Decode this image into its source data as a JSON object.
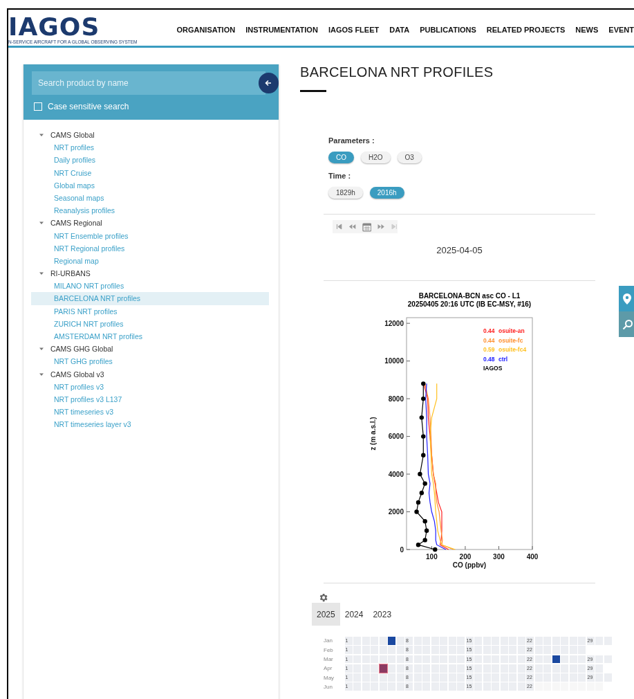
{
  "header": {
    "logo": "IAGOS",
    "tagline": "N-SERVICE AIRCRAFT FOR A GLOBAL OBSERVING SYSTEM",
    "nav": [
      "ORGANISATION",
      "INSTRUMENTATION",
      "IAGOS FLEET",
      "DATA",
      "PUBLICATIONS",
      "RELATED PROJECTS",
      "NEWS",
      "EVENT"
    ]
  },
  "sidebar": {
    "search": {
      "placeholder": "Search product by name"
    },
    "case_sensitive": {
      "label": "Case sensitive search",
      "checked": false
    },
    "tree": [
      {
        "label": "CAMS Global",
        "expanded": true,
        "children": [
          {
            "label": "NRT profiles",
            "selected": false
          },
          {
            "label": "Daily profiles",
            "selected": false
          },
          {
            "label": "NRT Cruise",
            "selected": false
          },
          {
            "label": "Global maps",
            "selected": false
          },
          {
            "label": "Seasonal maps",
            "selected": false
          },
          {
            "label": "Reanalysis profiles",
            "selected": false
          }
        ]
      },
      {
        "label": "CAMS Regional",
        "expanded": true,
        "children": [
          {
            "label": "NRT Ensemble profiles",
            "selected": false
          },
          {
            "label": "NRT Regional profiles",
            "selected": false
          },
          {
            "label": "Regional map",
            "selected": false
          }
        ]
      },
      {
        "label": "RI-URBANS",
        "expanded": true,
        "children": [
          {
            "label": "MILANO NRT profiles",
            "selected": false
          },
          {
            "label": "BARCELONA NRT profiles",
            "selected": true
          },
          {
            "label": "PARIS NRT profiles",
            "selected": false
          },
          {
            "label": "ZURICH NRT profiles",
            "selected": false
          },
          {
            "label": "AMSTERDAM NRT profiles",
            "selected": false
          }
        ]
      },
      {
        "label": "CAMS GHG Global",
        "expanded": true,
        "children": [
          {
            "label": "NRT GHG profiles",
            "selected": false
          }
        ]
      },
      {
        "label": "CAMS Global v3",
        "expanded": true,
        "children": [
          {
            "label": "NRT profiles v3",
            "selected": false
          },
          {
            "label": "NRT profiles v3 L137",
            "selected": false
          },
          {
            "label": "NRT timeseries v3",
            "selected": false
          },
          {
            "label": "NRT timeseries layer v3",
            "selected": false
          }
        ]
      }
    ]
  },
  "page_title": "BARCELONA NRT PROFILES",
  "parameters": {
    "label": "Parameters :",
    "options": [
      {
        "label": "CO",
        "selected": true
      },
      {
        "label": "H2O",
        "selected": false
      },
      {
        "label": "O3",
        "selected": false
      }
    ]
  },
  "time": {
    "label": "Time :",
    "options": [
      {
        "label": "1829h",
        "selected": false
      },
      {
        "label": "2016h",
        "selected": true
      }
    ]
  },
  "date": "2025-04-05",
  "profile": {
    "chart_data": {
      "type": "line",
      "orientation": "horizontal",
      "title": "BARCELONA-BCN asc CO - L1\n20250405 20:16 UTC (IB EC-MSY, #16)",
      "xlabel": "CO (ppbv)",
      "ylabel": "z (m a.s.l.)",
      "x": [
        0,
        250,
        500,
        1000,
        1500,
        2000,
        2500,
        3000,
        3500,
        4000,
        5000,
        6000,
        7000,
        8000,
        8800
      ],
      "xlim": [
        25,
        400
      ],
      "ylim": [
        0,
        12300
      ],
      "xticks": [
        100,
        200,
        300,
        400
      ],
      "yticks": [
        0,
        2000,
        4000,
        6000,
        8000,
        10000,
        12000
      ],
      "series": [
        {
          "name": "osuite-an",
          "color": "#ff2020",
          "values": [
            150,
            125,
            128,
            130,
            130,
            130,
            120,
            115,
            110,
            105,
            100,
            95,
            90,
            88,
            76
          ]
        },
        {
          "name": "osuite-fc",
          "color": "#ff9030",
          "values": [
            165,
            130,
            132,
            128,
            125,
            122,
            115,
            112,
            112,
            105,
            100,
            98,
            95,
            90,
            80
          ]
        },
        {
          "name": "osuite-fc4",
          "color": "#ffc020",
          "values": [
            170,
            130,
            125,
            118,
            115,
            112,
            110,
            108,
            105,
            100,
            98,
            95,
            100,
            115,
            115
          ]
        },
        {
          "name": "ctrl",
          "color": "#2020ff",
          "values": [
            142,
            115,
            112,
            112,
            108,
            100,
            95,
            92,
            95,
            90,
            88,
            85,
            85,
            82,
            85
          ]
        },
        {
          "name": "IAGOS",
          "color": "#000000",
          "marker": "circle",
          "values": [
            110,
            60,
            80,
            85,
            80,
            55,
            60,
            70,
            80,
            65,
            75,
            75,
            70,
            75,
            75
          ]
        }
      ],
      "annotations": [
        "0.44",
        "0.44",
        "0.59",
        "0.48"
      ]
    }
  },
  "years": [
    {
      "label": "2025",
      "selected": true
    },
    {
      "label": "2024",
      "selected": false
    },
    {
      "label": "2023",
      "selected": false
    }
  ],
  "calendar": [
    {
      "month": "Jan",
      "cells": [
        {
          "kind": "empty",
          "label": "1"
        },
        {
          "kind": "empty"
        },
        {
          "kind": "empty"
        },
        {
          "kind": "empty"
        },
        {
          "kind": "empty"
        },
        {
          "kind": "data"
        },
        {
          "kind": "empty"
        },
        {
          "kind": "empty",
          "label": "8"
        },
        {
          "kind": "empty"
        },
        {
          "kind": "empty"
        },
        {
          "kind": "empty"
        },
        {
          "kind": "empty"
        },
        {
          "kind": "empty"
        },
        {
          "kind": "empty"
        },
        {
          "kind": "empty",
          "label": "15"
        },
        {
          "kind": "empty"
        },
        {
          "kind": "empty"
        },
        {
          "kind": "empty"
        },
        {
          "kind": "empty"
        },
        {
          "kind": "empty"
        },
        {
          "kind": "empty"
        },
        {
          "kind": "empty",
          "label": "22"
        },
        {
          "kind": "empty"
        },
        {
          "kind": "empty"
        },
        {
          "kind": "empty"
        },
        {
          "kind": "empty"
        },
        {
          "kind": "empty"
        },
        {
          "kind": "empty"
        },
        {
          "kind": "empty",
          "label": "29"
        },
        {
          "kind": "empty"
        },
        {
          "kind": "empty"
        }
      ]
    },
    {
      "month": "Feb",
      "cells": [
        {
          "kind": "empty",
          "label": "1"
        },
        {
          "kind": "empty"
        },
        {
          "kind": "empty"
        },
        {
          "kind": "empty"
        },
        {
          "kind": "empty"
        },
        {
          "kind": "empty"
        },
        {
          "kind": "empty"
        },
        {
          "kind": "empty",
          "label": "8"
        },
        {
          "kind": "empty"
        },
        {
          "kind": "empty"
        },
        {
          "kind": "empty"
        },
        {
          "kind": "empty"
        },
        {
          "kind": "empty"
        },
        {
          "kind": "empty"
        },
        {
          "kind": "empty",
          "label": "15"
        },
        {
          "kind": "empty"
        },
        {
          "kind": "empty"
        },
        {
          "kind": "empty"
        },
        {
          "kind": "empty"
        },
        {
          "kind": "empty"
        },
        {
          "kind": "empty"
        },
        {
          "kind": "empty",
          "label": "22"
        },
        {
          "kind": "empty"
        },
        {
          "kind": "empty"
        },
        {
          "kind": "empty"
        },
        {
          "kind": "empty"
        },
        {
          "kind": "empty"
        },
        {
          "kind": "empty"
        }
      ]
    },
    {
      "month": "Mar",
      "cells": [
        {
          "kind": "empty",
          "label": "1"
        },
        {
          "kind": "empty"
        },
        {
          "kind": "empty"
        },
        {
          "kind": "empty"
        },
        {
          "kind": "empty"
        },
        {
          "kind": "empty"
        },
        {
          "kind": "empty"
        },
        {
          "kind": "empty",
          "label": "8"
        },
        {
          "kind": "empty"
        },
        {
          "kind": "empty"
        },
        {
          "kind": "empty"
        },
        {
          "kind": "empty"
        },
        {
          "kind": "empty"
        },
        {
          "kind": "empty"
        },
        {
          "kind": "empty",
          "label": "15"
        },
        {
          "kind": "empty"
        },
        {
          "kind": "empty"
        },
        {
          "kind": "empty"
        },
        {
          "kind": "empty"
        },
        {
          "kind": "empty"
        },
        {
          "kind": "empty"
        },
        {
          "kind": "empty",
          "label": "22"
        },
        {
          "kind": "empty"
        },
        {
          "kind": "empty"
        },
        {
          "kind": "data"
        },
        {
          "kind": "empty"
        },
        {
          "kind": "empty"
        },
        {
          "kind": "empty"
        },
        {
          "kind": "empty",
          "label": "29"
        },
        {
          "kind": "empty"
        },
        {
          "kind": "empty"
        }
      ]
    },
    {
      "month": "Apr",
      "cells": [
        {
          "kind": "empty",
          "label": "1"
        },
        {
          "kind": "empty"
        },
        {
          "kind": "empty"
        },
        {
          "kind": "empty"
        },
        {
          "kind": "selected"
        },
        {
          "kind": "empty"
        },
        {
          "kind": "empty"
        },
        {
          "kind": "empty",
          "label": "8"
        },
        {
          "kind": "empty"
        },
        {
          "kind": "empty"
        },
        {
          "kind": "empty"
        },
        {
          "kind": "empty"
        },
        {
          "kind": "empty"
        },
        {
          "kind": "empty"
        },
        {
          "kind": "empty",
          "label": "15"
        },
        {
          "kind": "empty"
        },
        {
          "kind": "empty"
        },
        {
          "kind": "empty"
        },
        {
          "kind": "empty"
        },
        {
          "kind": "empty"
        },
        {
          "kind": "empty"
        },
        {
          "kind": "empty",
          "label": "22"
        },
        {
          "kind": "empty"
        },
        {
          "kind": "empty"
        },
        {
          "kind": "empty"
        },
        {
          "kind": "empty"
        },
        {
          "kind": "empty"
        },
        {
          "kind": "empty"
        },
        {
          "kind": "empty",
          "label": "29"
        },
        {
          "kind": "empty"
        }
      ]
    },
    {
      "month": "May",
      "cells": [
        {
          "kind": "empty",
          "label": "1"
        },
        {
          "kind": "empty"
        },
        {
          "kind": "empty"
        },
        {
          "kind": "empty"
        },
        {
          "kind": "empty"
        },
        {
          "kind": "empty"
        },
        {
          "kind": "empty"
        },
        {
          "kind": "empty",
          "label": "8"
        },
        {
          "kind": "empty"
        },
        {
          "kind": "empty"
        },
        {
          "kind": "empty"
        },
        {
          "kind": "empty"
        },
        {
          "kind": "empty"
        },
        {
          "kind": "empty"
        },
        {
          "kind": "empty",
          "label": "15"
        },
        {
          "kind": "empty"
        },
        {
          "kind": "empty"
        },
        {
          "kind": "empty"
        },
        {
          "kind": "empty"
        },
        {
          "kind": "empty"
        },
        {
          "kind": "empty"
        },
        {
          "kind": "empty",
          "label": "22"
        },
        {
          "kind": "empty"
        },
        {
          "kind": "empty"
        },
        {
          "kind": "empty"
        },
        {
          "kind": "empty"
        },
        {
          "kind": "empty"
        },
        {
          "kind": "empty"
        },
        {
          "kind": "empty",
          "label": "29"
        },
        {
          "kind": "empty"
        },
        {
          "kind": "empty"
        }
      ]
    },
    {
      "month": "Jun",
      "cells": [
        {
          "kind": "empty",
          "label": "1"
        },
        {
          "kind": "empty"
        },
        {
          "kind": "empty"
        },
        {
          "kind": "empty"
        },
        {
          "kind": "empty"
        },
        {
          "kind": "empty"
        },
        {
          "kind": "empty"
        },
        {
          "kind": "empty",
          "label": "8"
        },
        {
          "kind": "empty"
        },
        {
          "kind": "empty"
        },
        {
          "kind": "empty"
        },
        {
          "kind": "empty"
        },
        {
          "kind": "empty"
        },
        {
          "kind": "empty"
        },
        {
          "kind": "empty",
          "label": "15"
        },
        {
          "kind": "empty"
        },
        {
          "kind": "empty"
        },
        {
          "kind": "empty"
        },
        {
          "kind": "empty"
        },
        {
          "kind": "empty"
        },
        {
          "kind": "empty"
        },
        {
          "kind": "empty",
          "label": "22"
        },
        {
          "kind": "future"
        },
        {
          "kind": "future"
        },
        {
          "kind": "future"
        },
        {
          "kind": "future"
        },
        {
          "kind": "future"
        },
        {
          "kind": "future"
        },
        {
          "kind": "future"
        },
        {
          "kind": "future"
        }
      ]
    }
  ]
}
